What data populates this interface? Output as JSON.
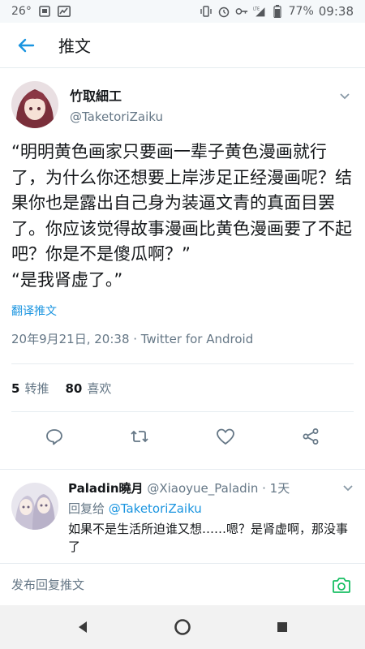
{
  "status_bar": {
    "left_number": "26°",
    "battery": "77%",
    "time": "09:38",
    "lte_label": "LTE"
  },
  "header": {
    "title": "推文",
    "back_icon": "arrow-left-icon"
  },
  "tweet": {
    "display_name": "竹取細工",
    "handle": "@TaketoriZaiku",
    "text_lines": [
      "“明明黄色画家只要画一辈子黄色漫画就行了，为什么你还想要上岸涉足正经漫画呢？结果你也是露出自己身为装逼文青的真面目罢了。你应该觉得故事漫画比黄色漫画要了不起吧？你是不是傻瓜啊？”",
      "“是我肾虚了。”"
    ],
    "translate_label": "翻译推文",
    "meta": "20年9月21日, 20:38 · Twitter for Android",
    "retweets_count": "5",
    "retweets_label": "转推",
    "likes_count": "80",
    "likes_label": "喜欢"
  },
  "reply": {
    "display_name": "Paladin曉月",
    "handle_time": "@Xiaoyue_Paladin · 1天",
    "reply_to_prefix": "回复给",
    "reply_to_handle": "@TaketoriZaiku",
    "text": "如果不是生活所迫谁又想……嗯？是肾虚啊，那没事了"
  },
  "compose": {
    "placeholder": "发布回复推文"
  },
  "colors": {
    "accent": "#1b95e0",
    "text": "#14171a",
    "muted": "#657786",
    "divider": "#e6ecf0"
  }
}
